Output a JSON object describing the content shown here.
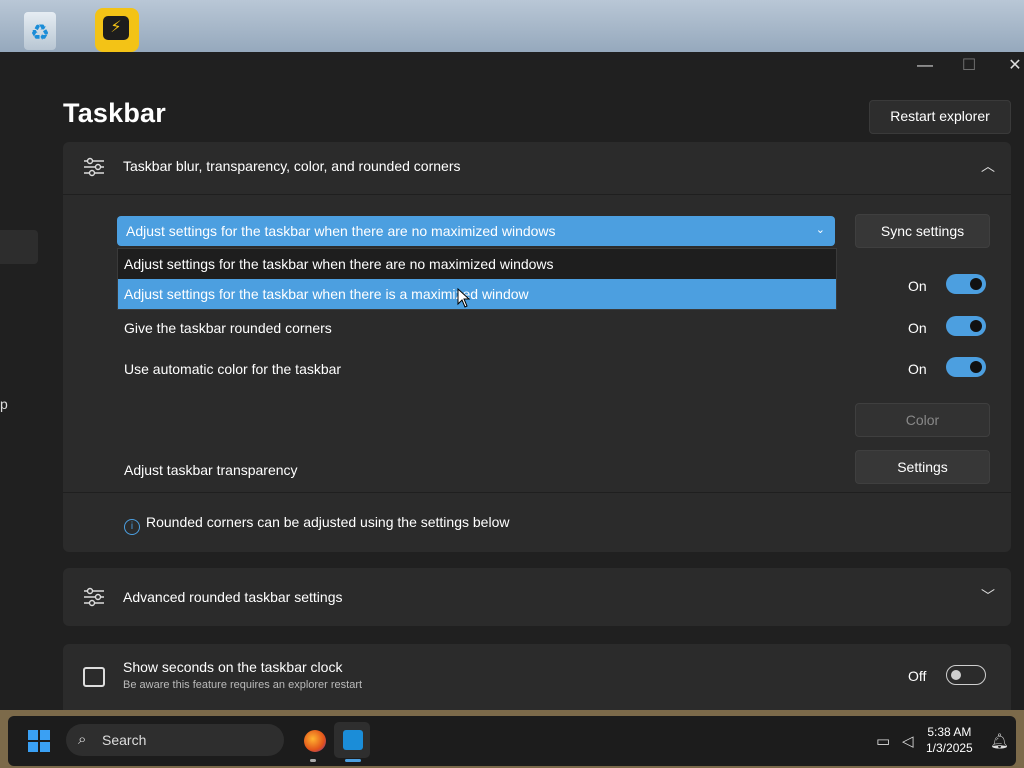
{
  "window": {
    "title": "Taskbar",
    "restart_button": "Restart explorer"
  },
  "blur_section": {
    "title": "Taskbar blur, transparency, color, and rounded corners",
    "dropdown_value": "Adjust settings for the taskbar when there are no maximized windows",
    "dropdown_options": [
      "Adjust settings for the taskbar when there are no maximized windows",
      "Adjust settings for the taskbar when there is a maximized window"
    ],
    "sync_button": "Sync settings",
    "first_toggle_state": "On",
    "rounded_corners_label": "Give the taskbar rounded corners",
    "rounded_corners_state": "On",
    "auto_color_label": "Use automatic color for the taskbar",
    "auto_color_state": "On",
    "color_button": "Color",
    "transparency_label": "Adjust taskbar transparency",
    "settings_button": "Settings",
    "info_text": "Rounded corners can be adjusted using the settings below"
  },
  "advanced_section": {
    "title": "Advanced rounded taskbar settings"
  },
  "seconds_section": {
    "title": "Show seconds on the taskbar clock",
    "subtitle": "Be aware this feature requires an explorer restart",
    "state": "Off"
  },
  "taskbar": {
    "search_placeholder": "Search",
    "time": "5:38 AM",
    "date": "1/3/2025"
  },
  "sidebar": {
    "partial_text": "p"
  },
  "colors": {
    "accent": "#4c9fe0",
    "background": "#202020",
    "card": "#2b2b2b"
  }
}
